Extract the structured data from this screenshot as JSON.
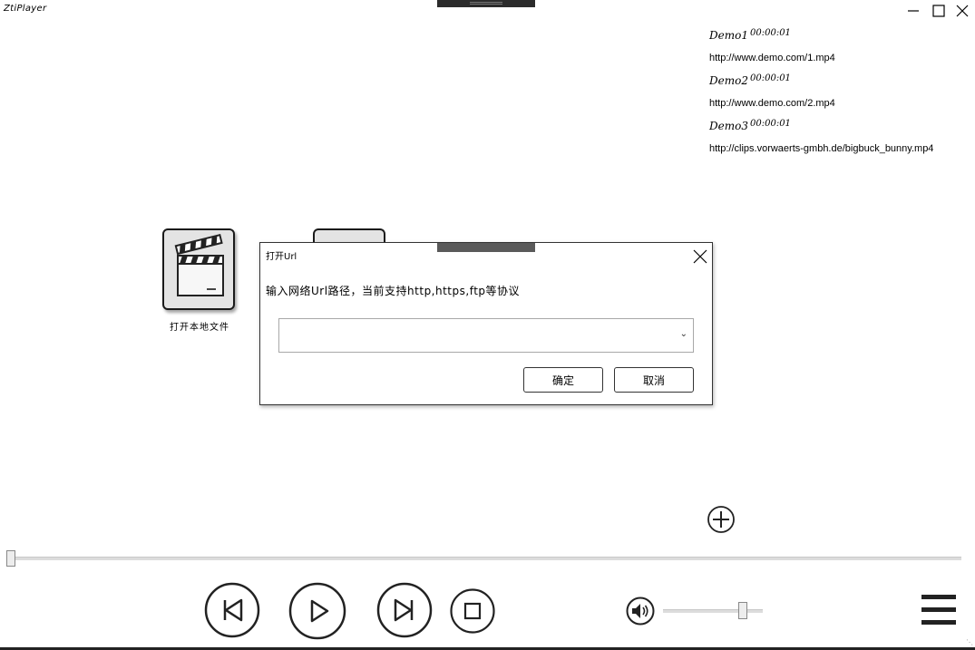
{
  "app": {
    "title": "ZtiPlayer"
  },
  "playlist": [
    {
      "title": "Demo1",
      "duration": "00:00:01",
      "url": "http://www.demo.com/1.mp4"
    },
    {
      "title": "Demo2",
      "duration": "00:00:01",
      "url": "http://www.demo.com/2.mp4"
    },
    {
      "title": "Demo3",
      "duration": "00:00:01",
      "url": "http://clips.vorwaerts-gmbh.de/bigbuck_bunny.mp4"
    }
  ],
  "tiles": {
    "open_local_label": "打开本地文件"
  },
  "dialog": {
    "title": "打开Url",
    "message": "输入网络Url路径，当前支持http,https,ftp等协议",
    "url_value": "",
    "ok_label": "确定",
    "cancel_label": "取消"
  },
  "player": {
    "seek_progress": 0.0,
    "volume": 0.8
  },
  "icons": {
    "window": [
      "minimize-icon",
      "maximize-icon",
      "close-icon"
    ],
    "controls": [
      "previous-icon",
      "play-icon",
      "next-icon",
      "stop-icon",
      "volume-icon",
      "menu-icon",
      "add-icon",
      "clapperboard-icon"
    ]
  }
}
